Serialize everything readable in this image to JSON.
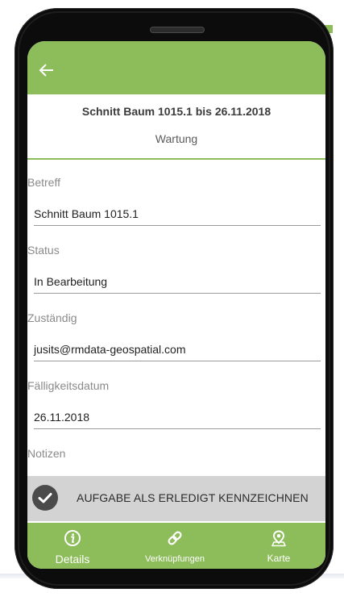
{
  "header": {
    "title": "Schnitt Baum 1015.1 bis 26.11.2018",
    "subtitle": "Wartung"
  },
  "fields": [
    {
      "label": "Betreff",
      "value": "Schnitt Baum 1015.1"
    },
    {
      "label": "Status",
      "value": "In Bearbeitung"
    },
    {
      "label": "Zuständig",
      "value": "jusits@rmdata-geospatial.com"
    },
    {
      "label": "Fälligkeitsdatum",
      "value": "26.11.2018"
    },
    {
      "label": "Notizen",
      "value": ""
    }
  ],
  "action": {
    "label": "AUFGABE ALS ERLEDIGT KENNZEICHNEN"
  },
  "nav": [
    {
      "label": "Details",
      "icon": "info-icon"
    },
    {
      "label": "Verknüpfungen",
      "icon": "link-icon"
    },
    {
      "label": "Karte",
      "icon": "map-pin-icon"
    }
  ],
  "colors": {
    "accent": "#8dbc5a",
    "action_bar": "#d3d3d3"
  }
}
